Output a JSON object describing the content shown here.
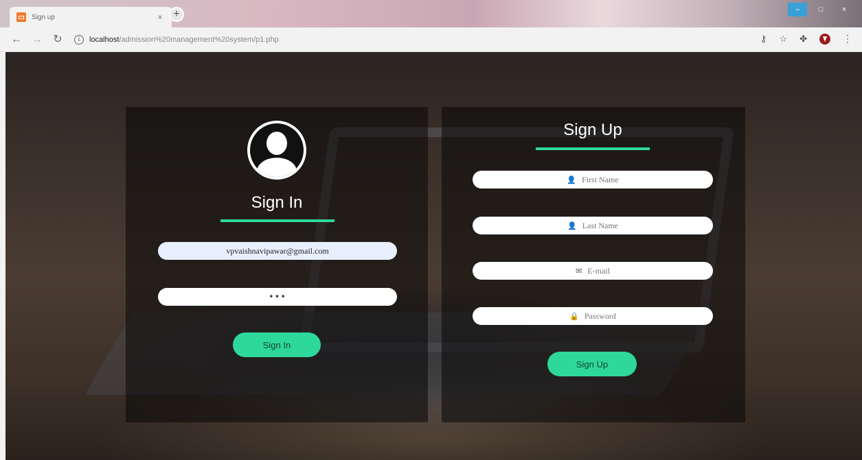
{
  "browser": {
    "tab_title": "Sign up",
    "tab_close": "×",
    "new_tab": "+",
    "url_host": "localhost",
    "url_path": "/admission%20management%20system/p1.php",
    "window_controls": {
      "minimize": "–",
      "maximize": "□",
      "close": "×"
    }
  },
  "sign_in": {
    "heading": "Sign In",
    "email_value": "vpvaishnavipawar@gmail.com",
    "password_value": "•••",
    "button": "Sign In"
  },
  "sign_up": {
    "heading": "Sign Up",
    "first_name_placeholder": "First Name",
    "last_name_placeholder": "Last Name",
    "email_placeholder": "E-mail",
    "password_placeholder": "Password",
    "button": "Sign Up"
  },
  "icons": {
    "user": "user-icon",
    "envelope": "envelope-icon",
    "lock": "lock-icon"
  },
  "colors": {
    "accent": "#2ed89a"
  }
}
